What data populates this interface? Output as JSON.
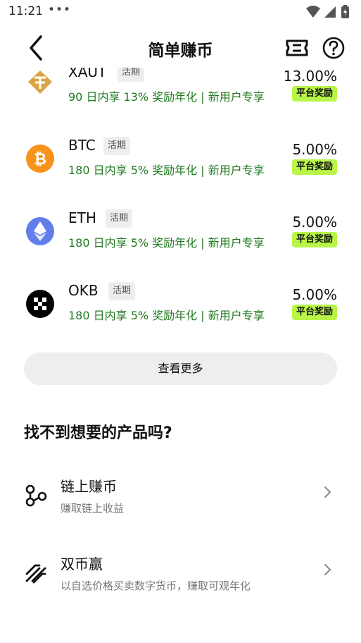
{
  "status": {
    "time": "11:21",
    "dots": "•••"
  },
  "nav": {
    "title": "简单赚币"
  },
  "products": [
    {
      "coin": "XAUT",
      "icon": "tether-gold-icon",
      "color": "#d9a441",
      "tag": "活期",
      "desc": "90 日内享 13% 奖励年化 | 新用户专享",
      "rate": "13.00%",
      "badge": "平台奖励"
    },
    {
      "coin": "BTC",
      "icon": "bitcoin-icon",
      "color": "#f7931a",
      "tag": "活期",
      "desc": "180 日内享 5% 奖励年化 | 新用户专享",
      "rate": "5.00%",
      "badge": "平台奖励"
    },
    {
      "coin": "ETH",
      "icon": "ethereum-icon",
      "color": "#627eea",
      "tag": "活期",
      "desc": "180 日内享 5% 奖励年化 | 新用户专享",
      "rate": "5.00%",
      "badge": "平台奖励"
    },
    {
      "coin": "OKB",
      "icon": "okb-icon",
      "color": "#000000",
      "tag": "活期",
      "desc": "180 日内享 5% 奖励年化 | 新用户专享",
      "rate": "5.00%",
      "badge": "平台奖励"
    }
  ],
  "more_button": "查看更多",
  "section_title": "找不到想要的产品吗?",
  "options": [
    {
      "title": "链上赚币",
      "subtitle": "赚取链上收益",
      "icon": "onchain-nodes-icon"
    },
    {
      "title": "双币赢",
      "subtitle": "以自选价格买卖数字货币，赚取可观年化",
      "icon": "dual-currency-icon"
    }
  ],
  "colors": {
    "accent_green_text": "#1f7a1f",
    "badge_bg": "#b8f547"
  }
}
